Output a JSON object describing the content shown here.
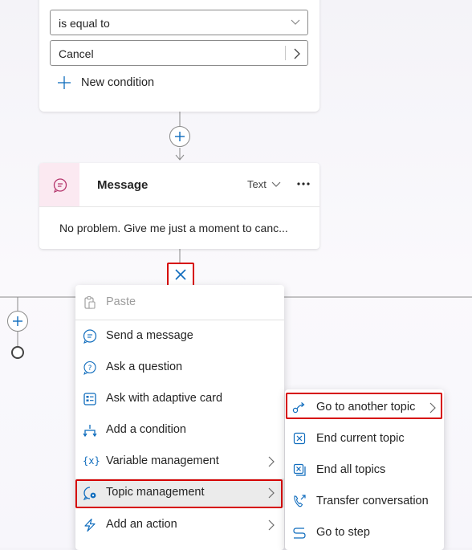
{
  "condition_card": {
    "operator_value": "is equal to",
    "compare_value": "Cancel",
    "new_condition_label": "New condition"
  },
  "message_card": {
    "title": "Message",
    "format_label": "Text",
    "body_text": "No problem. Give me just a moment to canc..."
  },
  "context_menu": {
    "items": [
      {
        "label": "Paste",
        "icon": "paste-icon",
        "disabled": true
      },
      {
        "label": "Send a message",
        "icon": "message-icon"
      },
      {
        "label": "Ask a question",
        "icon": "question-icon"
      },
      {
        "label": "Ask with adaptive card",
        "icon": "adaptive-card-icon"
      },
      {
        "label": "Add a condition",
        "icon": "branch-icon"
      },
      {
        "label": "Variable management",
        "icon": "variable-icon",
        "has_submenu": true
      },
      {
        "label": "Topic management",
        "icon": "topic-icon",
        "has_submenu": true,
        "highlighted": true
      },
      {
        "label": "Add an action",
        "icon": "action-icon",
        "has_submenu": true
      }
    ]
  },
  "submenu": {
    "items": [
      {
        "label": "Go to another topic",
        "icon": "redirect-icon",
        "has_submenu": true,
        "highlighted": true
      },
      {
        "label": "End current topic",
        "icon": "end-topic-icon"
      },
      {
        "label": "End all topics",
        "icon": "end-all-icon"
      },
      {
        "label": "Transfer conversation",
        "icon": "transfer-icon"
      },
      {
        "label": "Go to step",
        "icon": "go-to-step-icon"
      }
    ]
  },
  "colors": {
    "accent": "#0f6cbd",
    "highlight": "#d60000",
    "message_icon_bg": "#fbe9f1",
    "message_icon": "#b4346b",
    "menu_selected_bg": "#ebebeb"
  }
}
